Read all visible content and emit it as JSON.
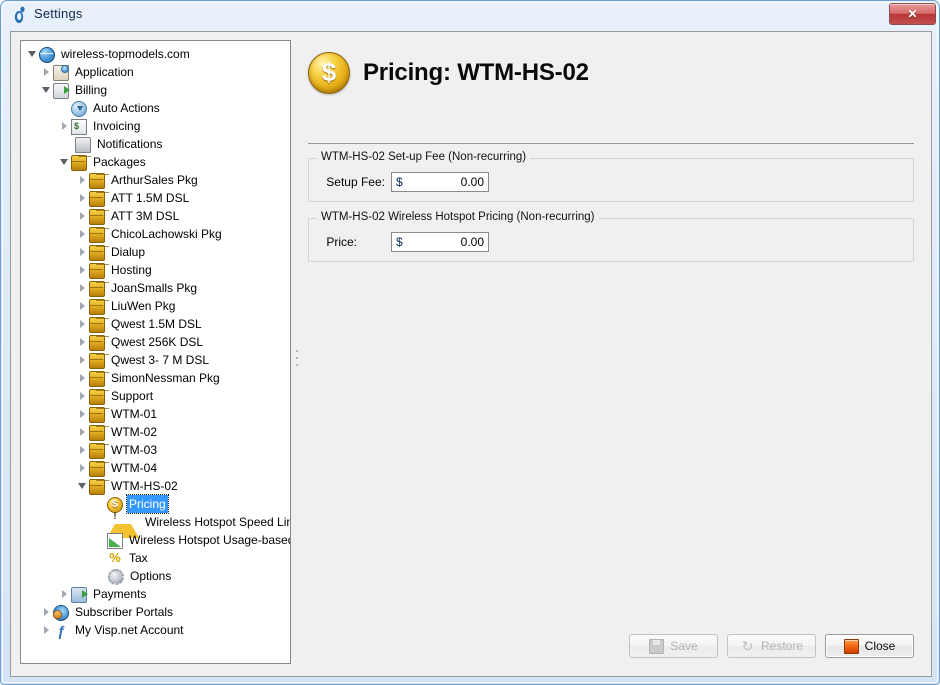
{
  "window": {
    "title": "Settings",
    "title_icon": "visp-footprint-icon",
    "close_button_glyph": "✕"
  },
  "tree": {
    "items": [
      {
        "label": "wireless-topmodels.com",
        "level": 0,
        "icon": "globe-icon",
        "state": "expanded",
        "selected": false
      },
      {
        "label": "Application",
        "level": 1,
        "icon": "application-icon",
        "state": "collapsed",
        "selected": false
      },
      {
        "label": "Billing",
        "level": 1,
        "icon": "billing-icon",
        "state": "expanded",
        "selected": false
      },
      {
        "label": "Auto Actions",
        "level": 2,
        "icon": "clock-icon",
        "state": "leaf",
        "selected": false
      },
      {
        "label": "Invoicing",
        "level": 2,
        "icon": "invoice-icon",
        "state": "collapsed",
        "selected": false
      },
      {
        "label": "Notifications",
        "level": 2,
        "icon": "notification-icon",
        "state": "leaf",
        "selected": false
      },
      {
        "label": "Packages",
        "level": 2,
        "icon": "package-icon",
        "state": "expanded",
        "selected": false
      },
      {
        "label": "ArthurSales Pkg",
        "level": 3,
        "icon": "package-icon",
        "state": "collapsed",
        "selected": false
      },
      {
        "label": "ATT 1.5M DSL",
        "level": 3,
        "icon": "package-icon",
        "state": "collapsed",
        "selected": false
      },
      {
        "label": "ATT 3M DSL",
        "level": 3,
        "icon": "package-icon",
        "state": "collapsed",
        "selected": false
      },
      {
        "label": "ChicoLachowski Pkg",
        "level": 3,
        "icon": "package-icon",
        "state": "collapsed",
        "selected": false
      },
      {
        "label": "Dialup",
        "level": 3,
        "icon": "package-icon",
        "state": "collapsed",
        "selected": false
      },
      {
        "label": "Hosting",
        "level": 3,
        "icon": "package-icon",
        "state": "collapsed",
        "selected": false
      },
      {
        "label": "JoanSmalls Pkg",
        "level": 3,
        "icon": "package-icon",
        "state": "collapsed",
        "selected": false
      },
      {
        "label": "LiuWen Pkg",
        "level": 3,
        "icon": "package-icon",
        "state": "collapsed",
        "selected": false
      },
      {
        "label": "Qwest 1.5M DSL",
        "level": 3,
        "icon": "package-icon",
        "state": "collapsed",
        "selected": false
      },
      {
        "label": "Qwest 256K DSL",
        "level": 3,
        "icon": "package-icon",
        "state": "collapsed",
        "selected": false
      },
      {
        "label": "Qwest 3- 7 M DSL",
        "level": 3,
        "icon": "package-icon",
        "state": "collapsed",
        "selected": false
      },
      {
        "label": "SimonNessman Pkg",
        "level": 3,
        "icon": "package-icon",
        "state": "collapsed",
        "selected": false
      },
      {
        "label": "Support",
        "level": 3,
        "icon": "package-icon",
        "state": "collapsed",
        "selected": false
      },
      {
        "label": "WTM-01",
        "level": 3,
        "icon": "package-icon",
        "state": "collapsed",
        "selected": false
      },
      {
        "label": "WTM-02",
        "level": 3,
        "icon": "package-icon",
        "state": "collapsed",
        "selected": false
      },
      {
        "label": "WTM-03",
        "level": 3,
        "icon": "package-icon",
        "state": "collapsed",
        "selected": false
      },
      {
        "label": "WTM-04",
        "level": 3,
        "icon": "package-icon",
        "state": "collapsed",
        "selected": false
      },
      {
        "label": "WTM-HS-02",
        "level": 3,
        "icon": "package-icon",
        "state": "expanded",
        "selected": false
      },
      {
        "label": "Pricing",
        "level": 4,
        "icon": "dollar-coin-icon",
        "state": "leaf",
        "selected": true
      },
      {
        "label": "Wireless Hotspot Speed Limits",
        "level": 4,
        "icon": "warning-icon",
        "state": "leaf",
        "selected": false
      },
      {
        "label": "Wireless Hotspot Usage-based Billing",
        "level": 4,
        "icon": "chart-icon",
        "state": "leaf",
        "selected": false
      },
      {
        "label": "Tax",
        "level": 4,
        "icon": "percent-icon",
        "state": "leaf",
        "selected": false
      },
      {
        "label": "Options",
        "level": 4,
        "icon": "gear-icon",
        "state": "leaf",
        "selected": false
      },
      {
        "label": "Payments",
        "level": 2,
        "icon": "payments-icon",
        "state": "collapsed",
        "selected": false
      },
      {
        "label": "Subscriber Portals",
        "level": 1,
        "icon": "portal-icon",
        "state": "collapsed",
        "selected": false
      },
      {
        "label": "My Visp.net Account",
        "level": 1,
        "icon": "visp-footprint-icon",
        "state": "collapsed",
        "selected": false
      }
    ]
  },
  "page": {
    "title": "Pricing: WTM-HS-02",
    "title_icon": "dollar-coin-icon",
    "groups": [
      {
        "title": "WTM-HS-02 Set-up Fee (Non-recurring)",
        "field_label": "Setup Fee:",
        "currency": "$",
        "value": "0.00"
      },
      {
        "title": "WTM-HS-02 Wireless Hotspot Pricing (Non-recurring)",
        "field_label": "Price:",
        "currency": "$",
        "value": "0.00"
      }
    ]
  },
  "footer": {
    "save_label": "Save",
    "restore_label": "Restore",
    "close_label": "Close",
    "restore_glyph": "↻"
  }
}
